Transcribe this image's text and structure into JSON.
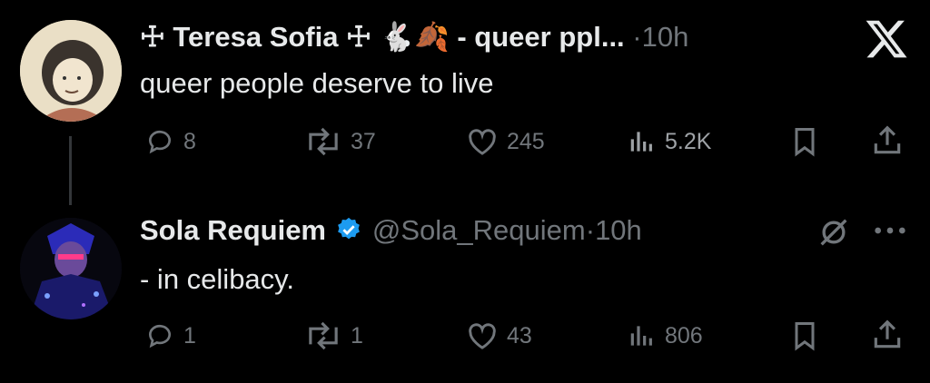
{
  "tweets": [
    {
      "display_name": "Teresa Sofia",
      "name_prefix_glyph": "☩",
      "name_suffix_glyph": "☩",
      "name_emoji": "🐇🍂",
      "name_extra": "- queer ppl...",
      "separator": "·",
      "time": "10h",
      "text": "queer people deserve to live",
      "replies": "8",
      "retweets": "37",
      "likes": "245",
      "views": "5.2K"
    },
    {
      "display_name": "Sola Requiem",
      "verified": true,
      "handle": "@Sola_Requiem",
      "separator": "·",
      "time": "10h",
      "text": "- in celibacy.",
      "replies": "1",
      "retweets": "1",
      "likes": "43",
      "views": "806"
    }
  ],
  "colors": {
    "background": "#000000",
    "text": "#e7e9ea",
    "muted": "#71767b",
    "verified": "#1d9bf0"
  },
  "icons": [
    "x-logo-icon",
    "grok-icon",
    "more-icon",
    "reply-icon",
    "retweet-icon",
    "like-icon",
    "views-icon",
    "bookmark-icon",
    "share-icon"
  ]
}
